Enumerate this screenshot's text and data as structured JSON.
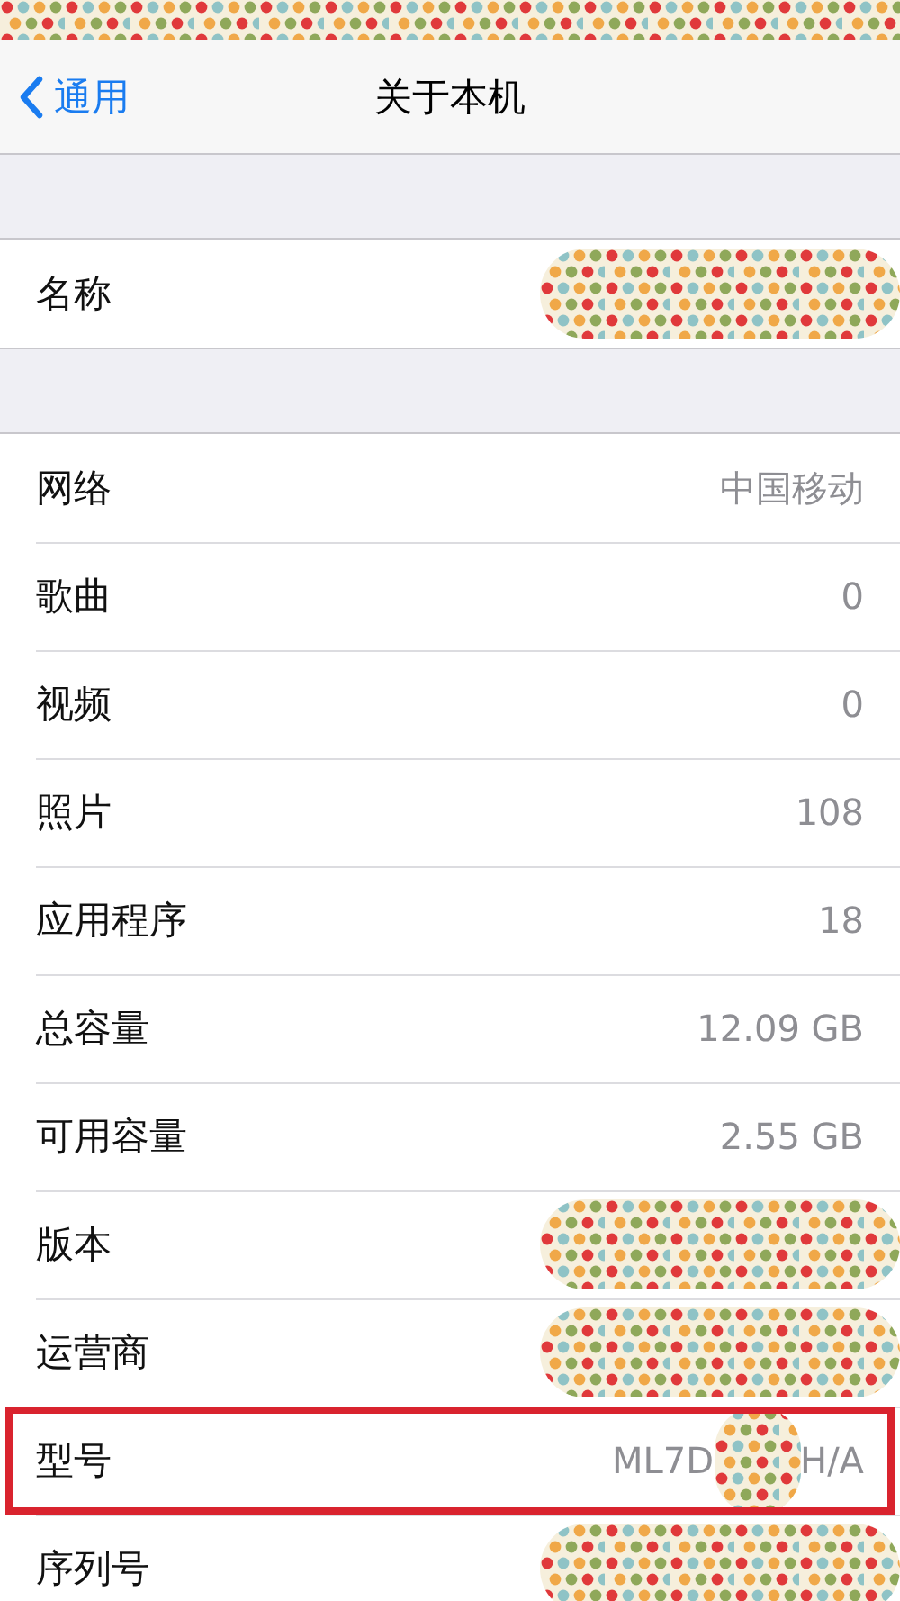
{
  "status_bar": {
    "redacted": true
  },
  "nav": {
    "back_label": "通用",
    "title": "关于本机"
  },
  "sections": [
    {
      "rows": [
        {
          "label": "名称",
          "redacted": true
        }
      ]
    },
    {
      "rows": [
        {
          "label": "网络",
          "value": "中国移动",
          "redacted": false
        },
        {
          "label": "歌曲",
          "value": "0",
          "redacted": false
        },
        {
          "label": "视频",
          "value": "0",
          "redacted": false
        },
        {
          "label": "照片",
          "value": "108",
          "redacted": false
        },
        {
          "label": "应用程序",
          "value": "18",
          "redacted": false
        },
        {
          "label": "总容量",
          "value": "12.09 GB",
          "redacted": false
        },
        {
          "label": "可用容量",
          "value": "2.55 GB",
          "redacted": false
        },
        {
          "label": "版本",
          "redacted": true
        },
        {
          "label": "运营商",
          "redacted": true
        },
        {
          "label": "型号",
          "value": "ML7D",
          "value_end": "H/A",
          "redacted": true,
          "highlighted": true
        },
        {
          "label": "序列号",
          "redacted": true
        }
      ]
    }
  ]
}
